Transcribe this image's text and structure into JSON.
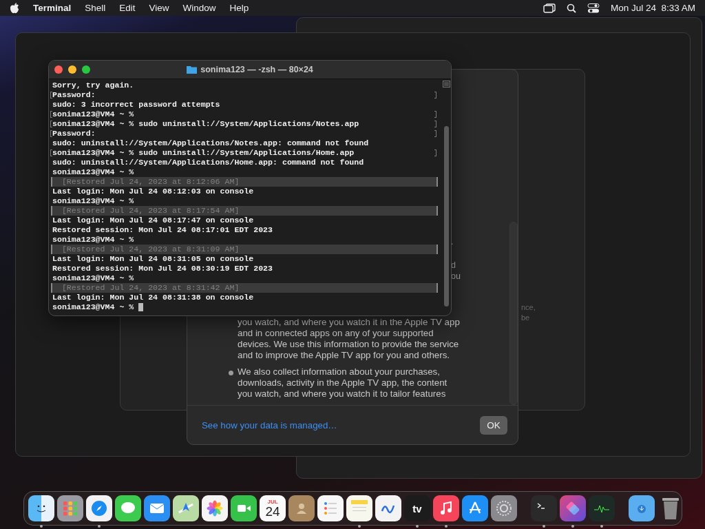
{
  "menu_bar": {
    "app": "Terminal",
    "items": [
      "Shell",
      "Edit",
      "View",
      "Window",
      "Help"
    ],
    "clock": "Mon Jul 24  8:33 AM"
  },
  "terminal": {
    "title": "sonima123 — -zsh — 80×24",
    "lines": [
      {
        "kind": "output",
        "text": "Sorry, try again.",
        "marked": false
      },
      {
        "kind": "output",
        "text": "Password:",
        "marked": true
      },
      {
        "kind": "output",
        "text": "sudo: 3 incorrect password attempts",
        "marked": false
      },
      {
        "kind": "output",
        "text": "sonima123@VM4 ~ %",
        "marked": true
      },
      {
        "kind": "output",
        "text": "sonima123@VM4 ~ % sudo uninstall://System/Applications/Notes.app",
        "marked": true
      },
      {
        "kind": "output",
        "text": "Password:",
        "marked": true
      },
      {
        "kind": "output",
        "text": "sudo: uninstall://System/Applications/Notes.app: command not found",
        "marked": false
      },
      {
        "kind": "output",
        "text": "sonima123@VM4 ~ % sudo uninstall://System/Applications/Home.app",
        "marked": true
      },
      {
        "kind": "output",
        "text": "sudo: uninstall://System/Applications/Home.app: command not found",
        "marked": false
      },
      {
        "kind": "output",
        "text": "sonima123@VM4 ~ %",
        "marked": false
      },
      {
        "kind": "restored",
        "text": "  [Restored Jul 24, 2023 at 8:12:06 AM]",
        "marked": false
      },
      {
        "kind": "output",
        "text": "Last login: Mon Jul 24 08:12:03 on console",
        "marked": false
      },
      {
        "kind": "output",
        "text": "sonima123@VM4 ~ %",
        "marked": false
      },
      {
        "kind": "restored",
        "text": "  [Restored Jul 24, 2023 at 8:17:54 AM]",
        "marked": false
      },
      {
        "kind": "output",
        "text": "Last login: Mon Jul 24 08:17:47 on console",
        "marked": false
      },
      {
        "kind": "output",
        "text": "Restored session: Mon Jul 24 08:17:01 EDT 2023",
        "marked": false
      },
      {
        "kind": "output",
        "text": "sonima123@VM4 ~ %",
        "marked": false
      },
      {
        "kind": "restored",
        "text": "  [Restored Jul 24, 2023 at 8:31:09 AM]",
        "marked": false
      },
      {
        "kind": "output",
        "text": "Last login: Mon Jul 24 08:31:05 on console",
        "marked": false
      },
      {
        "kind": "output",
        "text": "Restored session: Mon Jul 24 08:30:19 EDT 2023",
        "marked": false
      },
      {
        "kind": "output",
        "text": "sonima123@VM4 ~ %",
        "marked": false
      },
      {
        "kind": "restored",
        "text": "  [Restored Jul 24, 2023 at 8:31:42 AM]",
        "marked": false
      },
      {
        "kind": "output",
        "text": "Last login: Mon Jul 24 08:31:38 on console",
        "marked": false
      },
      {
        "kind": "prompt",
        "text": "sonima123@VM4 ~ % ",
        "marked": false
      }
    ]
  },
  "privacy_dialog": {
    "bullets": [
      {
        "lines": [
          "you watch, and where you watch it in the Apple TV app",
          "and in connected apps on any of your supported",
          "devices. We use this information to provide the service",
          "and to improve the Apple TV app for you and others."
        ],
        "bullet_visible": false
      },
      {
        "lines": [
          "We also collect information about your purchases,",
          "downloads, activity in the Apple TV app, the content",
          "you watch, and where you watch it to tailor features"
        ],
        "bullet_visible": true
      }
    ],
    "link": "See how your data is managed…",
    "ok_button": "OK"
  },
  "background_fragments": [
    {
      "lines": [
        "."
      ]
    },
    {
      "lines": [
        "d",
        "ou"
      ]
    },
    {
      "lines": [
        "nce,",
        "be"
      ]
    }
  ],
  "dock": {
    "apps": [
      {
        "kind": "finder",
        "running": true
      },
      {
        "kind": "launchpad",
        "running": false
      },
      {
        "kind": "safari",
        "running": true
      },
      {
        "kind": "messages",
        "running": false
      },
      {
        "kind": "mail",
        "running": false
      },
      {
        "kind": "maps",
        "running": false
      },
      {
        "kind": "photos",
        "running": false
      },
      {
        "kind": "facetime",
        "running": false
      },
      {
        "kind": "calendar",
        "running": false,
        "month": "JUL",
        "day": "24"
      },
      {
        "kind": "contacts",
        "running": false
      },
      {
        "kind": "reminders",
        "running": false
      },
      {
        "kind": "notes",
        "running": true
      },
      {
        "kind": "freeform",
        "running": false
      },
      {
        "kind": "tv",
        "running": true,
        "label": "tv"
      },
      {
        "kind": "music",
        "running": true
      },
      {
        "kind": "appstore",
        "running": false
      },
      {
        "kind": "settings",
        "running": false
      },
      {
        "kind": "separator"
      },
      {
        "kind": "terminal",
        "running": true
      },
      {
        "kind": "shortcuts",
        "running": true
      },
      {
        "kind": "activity",
        "running": true
      },
      {
        "kind": "separator"
      },
      {
        "kind": "downloads",
        "running": false
      },
      {
        "kind": "trash",
        "running": false
      }
    ]
  }
}
